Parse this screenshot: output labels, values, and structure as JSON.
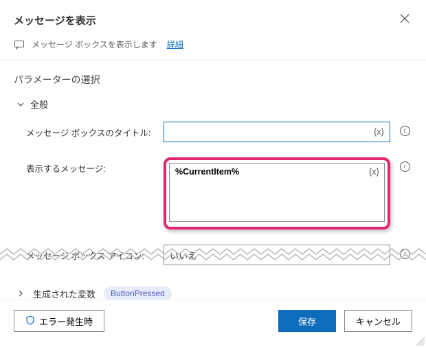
{
  "header": {
    "title": "メッセージを表示"
  },
  "description": {
    "text": "メッセージ ボックスを表示します",
    "link": "詳細"
  },
  "section_title": "パラメーターの選択",
  "group_general": "全般",
  "fields": {
    "title": {
      "label": "メッセージ ボックスのタイトル:",
      "value": ""
    },
    "message": {
      "label": "表示するメッセージ:",
      "value": "%CurrentItem%"
    },
    "icon": {
      "label": "メッセージ ボックス アイコン:",
      "value": "いいえ"
    }
  },
  "var_token": "{x}",
  "generated": {
    "label": "生成された変数",
    "pill": "ButtonPressed"
  },
  "footer": {
    "error": "エラー発生時",
    "save": "保存",
    "cancel": "キャンセル"
  }
}
